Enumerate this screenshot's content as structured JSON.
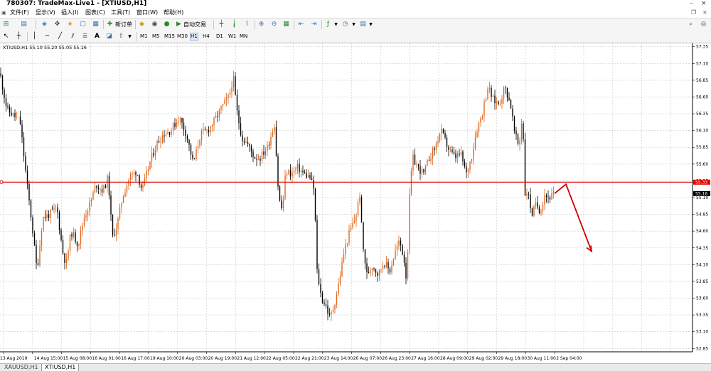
{
  "window": {
    "title": "780307: TradeMax-Live1 - [XTIUSD,H1]"
  },
  "menu": [
    "文件(F)",
    "显示(V)",
    "插入(I)",
    "图表(C)",
    "工具(T)",
    "窗口(W)",
    "帮助(H)"
  ],
  "toolbar": {
    "new_order_label": "新订单",
    "autotrade_label": "自动交易",
    "timeframes": [
      "M1",
      "M5",
      "M15",
      "M30",
      "H1",
      "H4",
      "D1",
      "W1",
      "MN"
    ]
  },
  "chart_info": "XTIUSD,H1  55.10 55.20 55.05 55.16",
  "price_line_label": "55.33",
  "last_price_label": "55.16",
  "colors": {
    "bull": "#e0661c",
    "bear": "#000000",
    "hline": "#e00000",
    "arrow": "#d00000",
    "grid": "#c8c8c8"
  },
  "tabs": [
    "XAUUSD,H1",
    "XTIUSD,H1"
  ],
  "chart_data": {
    "type": "candlestick",
    "symbol": "XTIUSD,H1",
    "y_ticks": [
      57.35,
      57.1,
      56.85,
      56.6,
      56.35,
      56.1,
      55.85,
      55.6,
      55.35,
      55.1,
      54.85,
      54.6,
      54.35,
      54.1,
      53.85,
      53.6,
      53.35,
      53.1,
      52.85
    ],
    "ylim": [
      52.8,
      57.4
    ],
    "x_ticks": [
      "13 Aug 2019",
      "14 Aug 15:00",
      "15 Aug 08:00",
      "16 Aug 01:00",
      "16 Aug 17:00",
      "19 Aug 10:00",
      "20 Aug 03:00",
      "20 Aug 19:00",
      "21 Aug 12:00",
      "22 Aug 05:00",
      "22 Aug 21:00",
      "23 Aug 14:00",
      "26 Aug 07:00",
      "26 Aug 23:00",
      "27 Aug 16:00",
      "28 Aug 09:00",
      "29 Aug 02:00",
      "29 Aug 18:00",
      "30 Aug 11:00",
      "2 Sep 04:00"
    ],
    "horizontal_line": 55.33,
    "last_price": 55.16,
    "projection": [
      [
        55.16,
        55.3
      ],
      [
        55.3,
        54.3
      ]
    ],
    "price_path": [
      [
        0,
        56.95
      ],
      [
        10,
        56.4
      ],
      [
        28,
        56.25
      ],
      [
        38,
        55.3
      ],
      [
        45,
        54.7
      ],
      [
        52,
        54.0
      ],
      [
        60,
        54.8
      ],
      [
        70,
        54.85
      ],
      [
        80,
        54.95
      ],
      [
        88,
        54.3
      ],
      [
        93,
        54.1
      ],
      [
        100,
        54.6
      ],
      [
        110,
        54.4
      ],
      [
        118,
        54.8
      ],
      [
        128,
        55.05
      ],
      [
        135,
        55.3
      ],
      [
        145,
        55.2
      ],
      [
        152,
        55.4
      ],
      [
        158,
        54.5
      ],
      [
        165,
        54.7
      ],
      [
        172,
        55.1
      ],
      [
        182,
        55.4
      ],
      [
        192,
        55.5
      ],
      [
        200,
        55.2
      ],
      [
        210,
        55.6
      ],
      [
        220,
        55.9
      ],
      [
        230,
        56.05
      ],
      [
        240,
        56.1
      ],
      [
        252,
        56.3
      ],
      [
        262,
        56.05
      ],
      [
        272,
        55.6
      ],
      [
        282,
        56.05
      ],
      [
        292,
        56.1
      ],
      [
        302,
        56.25
      ],
      [
        312,
        56.45
      ],
      [
        322,
        56.6
      ],
      [
        328,
        56.9
      ],
      [
        333,
        56.4
      ],
      [
        340,
        56.0
      ],
      [
        348,
        55.9
      ],
      [
        358,
        55.7
      ],
      [
        366,
        55.7
      ],
      [
        376,
        55.85
      ],
      [
        386,
        56.2
      ],
      [
        392,
        55.1
      ],
      [
        397,
        54.9
      ],
      [
        402,
        55.5
      ],
      [
        410,
        55.45
      ],
      [
        418,
        55.55
      ],
      [
        428,
        55.45
      ],
      [
        436,
        55.4
      ],
      [
        442,
        55.2
      ],
      [
        446,
        54.0
      ],
      [
        452,
        53.6
      ],
      [
        458,
        53.5
      ],
      [
        464,
        53.3
      ],
      [
        470,
        53.5
      ],
      [
        476,
        53.8
      ],
      [
        484,
        54.3
      ],
      [
        492,
        54.6
      ],
      [
        500,
        54.8
      ],
      [
        506,
        55.15
      ],
      [
        510,
        54.4
      ],
      [
        516,
        53.95
      ],
      [
        524,
        54.1
      ],
      [
        532,
        53.95
      ],
      [
        540,
        54.15
      ],
      [
        548,
        54.0
      ],
      [
        556,
        54.3
      ],
      [
        562,
        54.45
      ],
      [
        568,
        54.2
      ],
      [
        572,
        53.85
      ],
      [
        576,
        55.1
      ],
      [
        580,
        55.7
      ],
      [
        588,
        55.55
      ],
      [
        596,
        55.45
      ],
      [
        604,
        55.7
      ],
      [
        612,
        55.85
      ],
      [
        620,
        56.1
      ],
      [
        626,
        55.95
      ],
      [
        632,
        55.8
      ],
      [
        640,
        55.7
      ],
      [
        648,
        55.75
      ],
      [
        656,
        55.45
      ],
      [
        664,
        55.75
      ],
      [
        670,
        56.1
      ],
      [
        678,
        56.35
      ],
      [
        686,
        56.75
      ],
      [
        694,
        56.55
      ],
      [
        702,
        56.5
      ],
      [
        710,
        56.75
      ],
      [
        718,
        56.5
      ],
      [
        724,
        56.05
      ],
      [
        730,
        55.85
      ],
      [
        735,
        56.4
      ],
      [
        738,
        55.15
      ],
      [
        742,
        55.2
      ],
      [
        748,
        54.85
      ],
      [
        754,
        55.0
      ],
      [
        760,
        54.9
      ],
      [
        766,
        55.15
      ],
      [
        772,
        55.1
      ],
      [
        780,
        55.16
      ]
    ]
  }
}
